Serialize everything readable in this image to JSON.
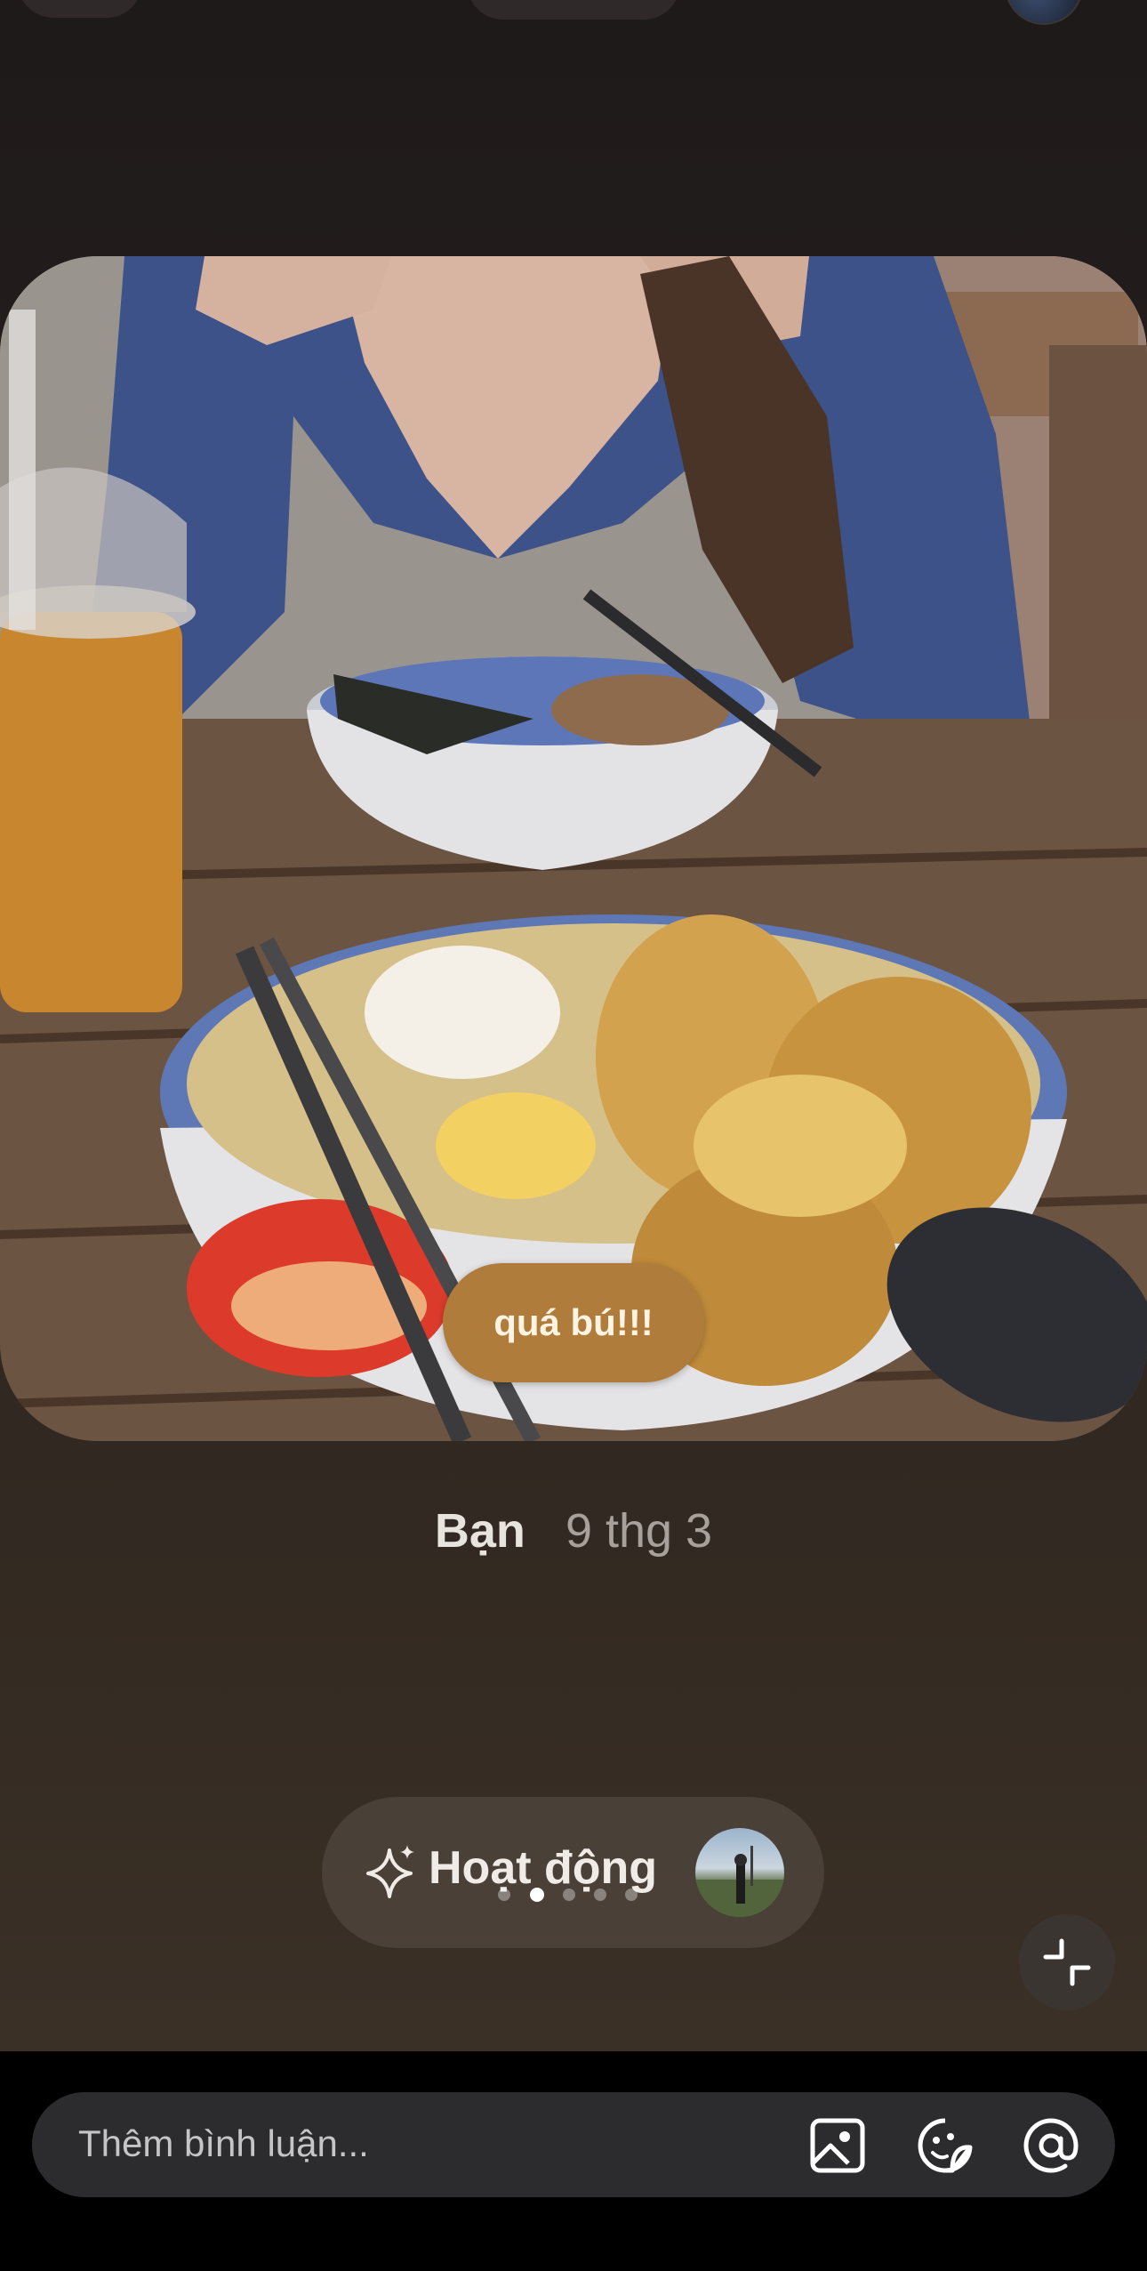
{
  "story": {
    "caption": "quá bú!!!",
    "author": "Bạn",
    "date": "9 thg 3"
  },
  "activity": {
    "label": "Hoạt động",
    "dots": 5,
    "active_dot": 2
  },
  "composer": {
    "placeholder": "Thêm bình luận..."
  },
  "icons": {
    "back": "chevron-left-icon",
    "sparkle": "sparkle-icon",
    "collapse": "collapse-arrows-icon",
    "image": "image-icon",
    "sticker": "sticker-icon",
    "mention": "at-sign-icon"
  },
  "colors": {
    "caption_bg": "#b07c3c",
    "bottom_bar": "#000000",
    "comment_box": "#2c2c2e"
  }
}
